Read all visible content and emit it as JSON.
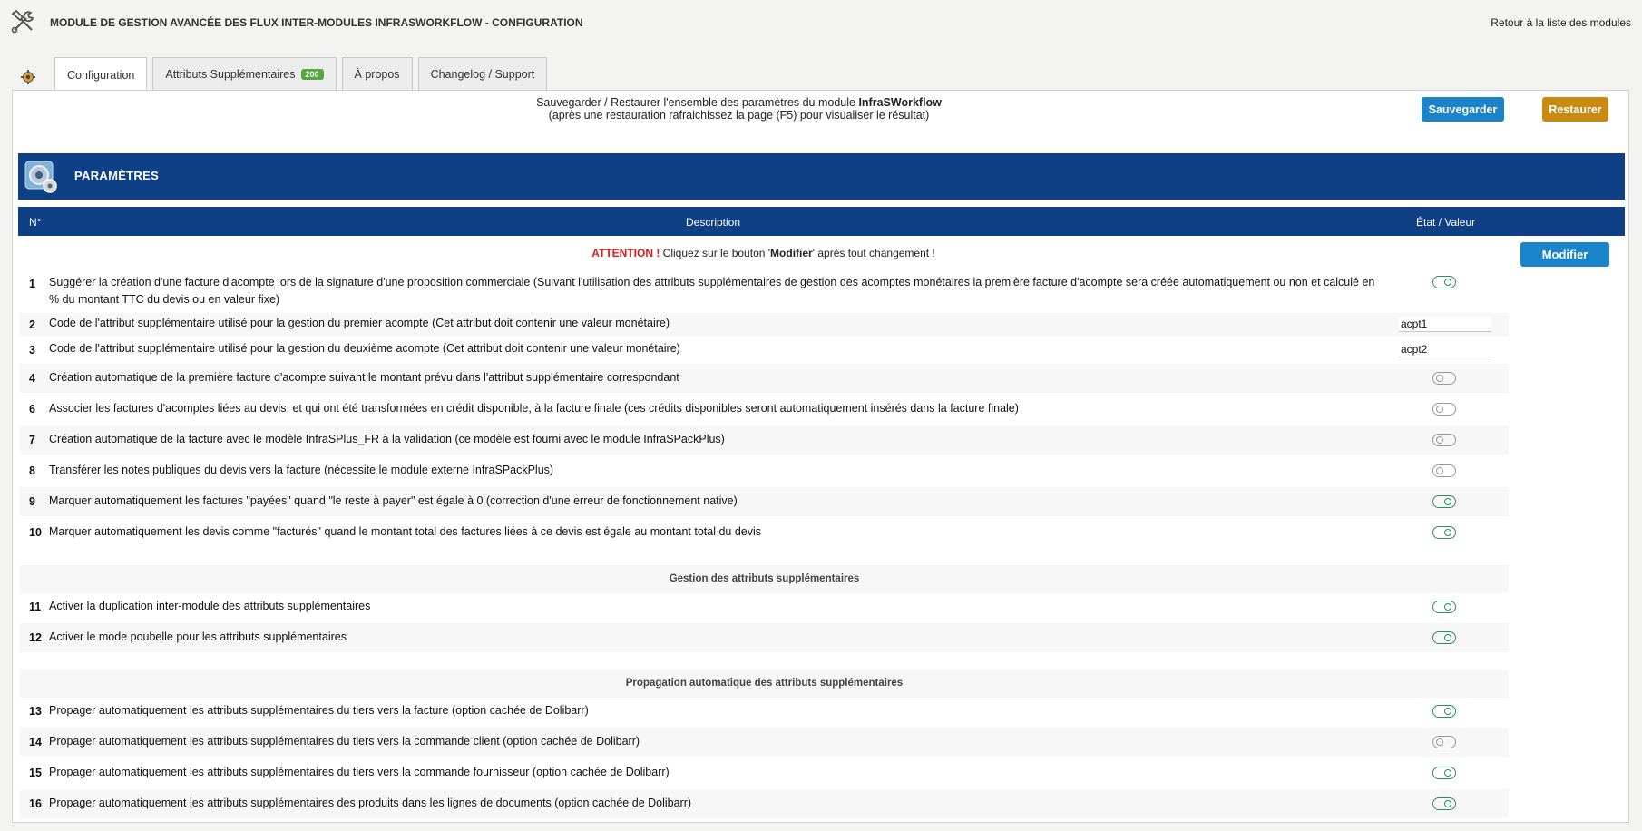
{
  "header": {
    "title": "MODULE DE GESTION AVANCÉE DES FLUX INTER-MODULES INFRASWORKFLOW - CONFIGURATION",
    "back_link": "Retour à la liste des modules"
  },
  "tabs": [
    {
      "label": "Configuration",
      "active": true
    },
    {
      "label": "Attributs Supplémentaires",
      "badge": "200"
    },
    {
      "label": "À propos"
    },
    {
      "label": "Changelog / Support"
    }
  ],
  "save_section": {
    "line1_prefix": "Sauvegarder / Restaurer l'ensemble des paramètres du module ",
    "module_name": "InfraSWorkflow",
    "line2": "(après une restauration rafraichissez la page (F5) pour visualiser le résultat)",
    "save_button": "Sauvegarder",
    "restore_button": "Restaurer"
  },
  "section_title": "PARAMÈTRES",
  "table_header": {
    "num": "N°",
    "description": "Description",
    "value": "État / Valeur"
  },
  "attention": {
    "label": "ATTENTION !",
    "text_before": " Cliquez sur le bouton '",
    "button_word": "Modifier",
    "text_after": "' après tout changement !"
  },
  "modify_button": "Modifier",
  "rows": [
    {
      "num": "1",
      "desc": "Suggérer la création d'une facture d'acompte lors de la signature d'une proposition commerciale (Suivant l'utilisation des attributs supplémentaires de gestion des acomptes monétaires la première facture d'acompte sera créée automatiquement ou non et calculé en % du montant TTC du devis ou en valeur fixe)",
      "type": "toggle",
      "on": true
    },
    {
      "num": "2",
      "desc": "Code de l'attribut supplémentaire utilisé pour la gestion du premier acompte (Cet attribut doit contenir une valeur monétaire)",
      "type": "input",
      "value": "acpt1"
    },
    {
      "num": "3",
      "desc": "Code de l'attribut supplémentaire utilisé pour la gestion du deuxième acompte (Cet attribut doit contenir une valeur monétaire)",
      "type": "input",
      "value": "acpt2"
    },
    {
      "num": "4",
      "desc": "Création automatique de la première facture d'acompte suivant le montant prévu dans l'attribut supplémentaire correspondant",
      "type": "toggle",
      "on": false
    },
    {
      "num": "6",
      "desc": "Associer les factures d'acomptes liées au devis, et qui ont été transformées en crédit disponible, à la facture finale (ces crédits disponibles seront automatiquement insérés dans la facture finale)",
      "type": "toggle",
      "on": false
    },
    {
      "num": "7",
      "desc": "Création automatique de la facture avec le modèle InfraSPlus_FR à la validation (ce modèle est fourni avec le module InfraSPackPlus)",
      "type": "toggle",
      "on": false
    },
    {
      "num": "8",
      "desc": "Transférer les notes publiques du devis vers la facture (nécessite le module externe InfraSPackPlus)",
      "type": "toggle",
      "on": false
    },
    {
      "num": "9",
      "desc": "Marquer automatiquement les factures \"payées\" quand \"le reste à payer\" est égale à 0 (correction d'une erreur de fonctionnement native)",
      "type": "toggle",
      "on": true
    },
    {
      "num": "10",
      "desc": "Marquer automatiquement les devis comme \"facturés\" quand le montant total des factures liées à ce devis est égale au montant total du devis",
      "type": "toggle",
      "on": true
    }
  ],
  "subsection1": "Gestion des attributs supplémentaires",
  "rows2": [
    {
      "num": "11",
      "desc": "Activer la duplication inter-module des attributs supplémentaires",
      "on": true
    },
    {
      "num": "12",
      "desc": "Activer le mode poubelle pour les attributs supplémentaires",
      "on": true
    }
  ],
  "subsection2": "Propagation automatique des attributs supplémentaires",
  "rows3": [
    {
      "num": "13",
      "desc": "Propager automatiquement les attributs supplémentaires du tiers vers la facture (option cachée de Dolibarr)",
      "on": true
    },
    {
      "num": "14",
      "desc": "Propager automatiquement les attributs supplémentaires du tiers vers la commande client (option cachée de Dolibarr)",
      "on": false
    },
    {
      "num": "15",
      "desc": "Propager automatiquement les attributs supplémentaires du tiers vers la commande fournisseur (option cachée de Dolibarr)",
      "on": true
    },
    {
      "num": "16",
      "desc": "Propager automatiquement les attributs supplémentaires des produits dans les lignes de documents (option cachée de Dolibarr)",
      "on": true
    }
  ],
  "colors": {
    "header_blue": "#0f3f85",
    "button_blue": "#1b83c8",
    "button_gold": "#c98a12",
    "toggle_on": "#2a8f5e",
    "badge_green": "#55a83c"
  },
  "icons": [
    "tools-icon",
    "gear-icon",
    "module-settings-icon",
    "toggle-on-icon",
    "toggle-off-icon"
  ]
}
